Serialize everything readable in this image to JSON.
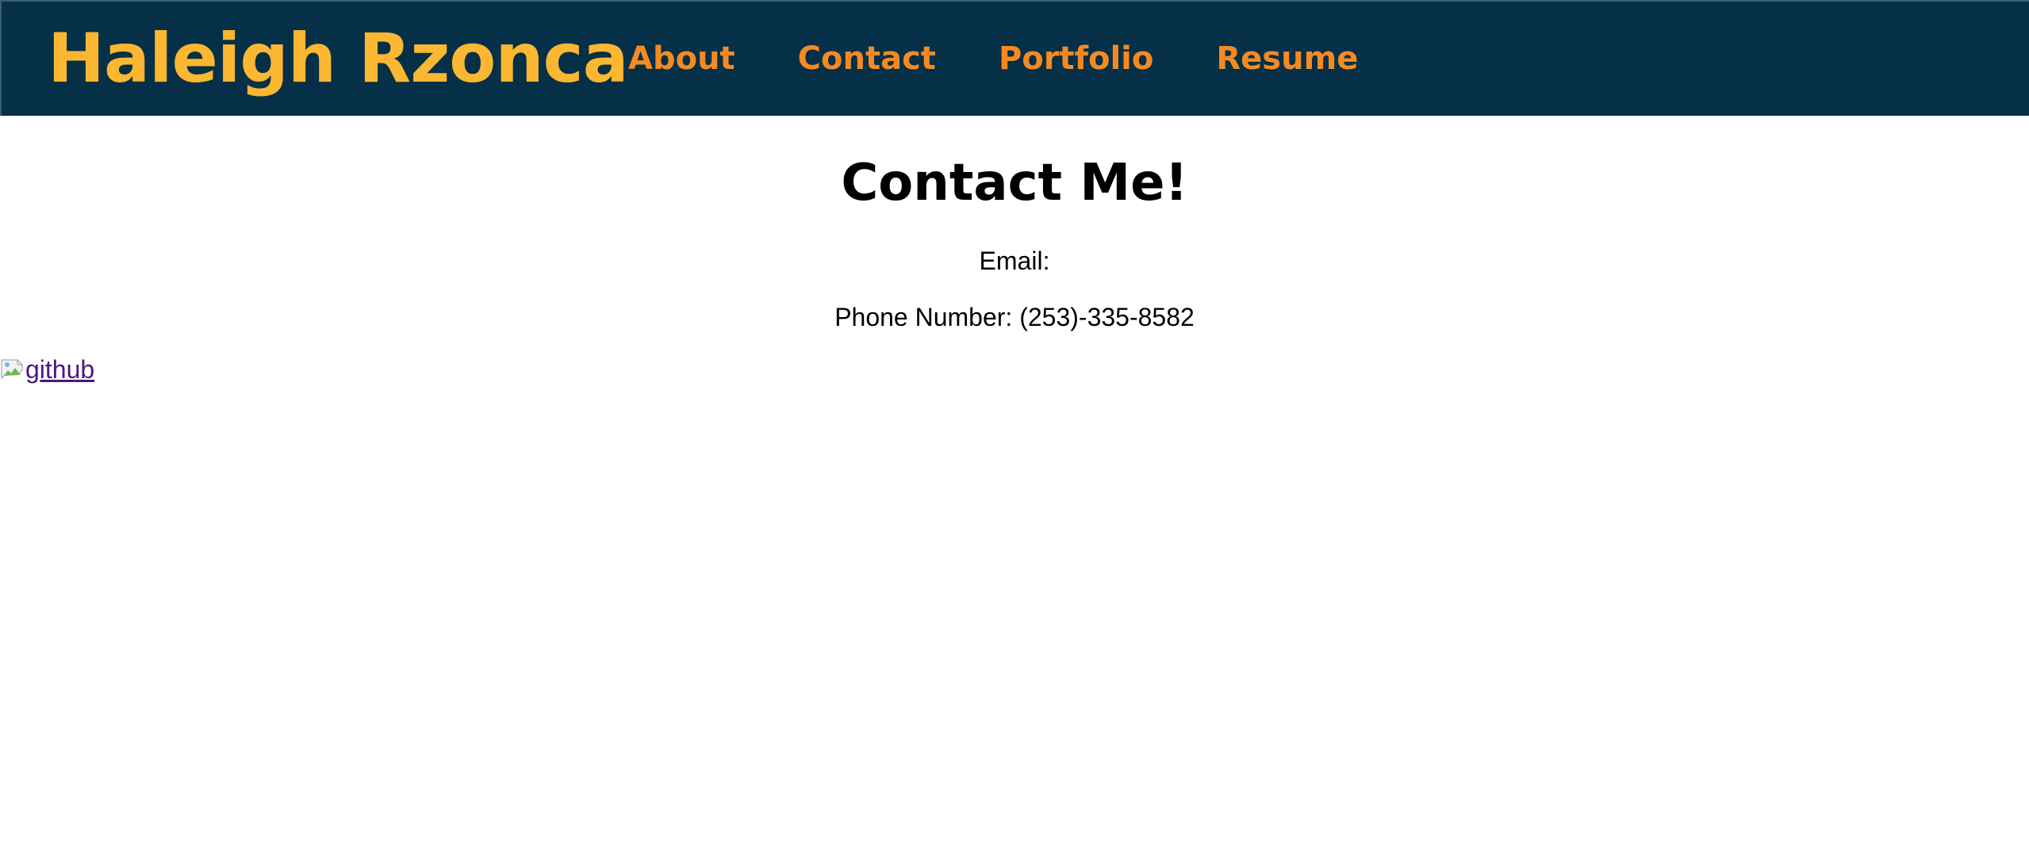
{
  "header": {
    "site_title": "Haleigh Rzonca",
    "nav": [
      {
        "label": "About"
      },
      {
        "label": "Contact"
      },
      {
        "label": "Portfolio"
      },
      {
        "label": "Resume"
      }
    ]
  },
  "main": {
    "heading": "Contact Me!",
    "email_label": "Email:",
    "phone_label": "Phone Number: (253)-335-8582",
    "github_alt": "github"
  },
  "colors": {
    "header_bg": "#053047",
    "title_color": "#fbb731",
    "nav_color": "#f58a23",
    "link_visited": "#4b1782"
  },
  "icons": {
    "github": "broken-image-icon"
  }
}
